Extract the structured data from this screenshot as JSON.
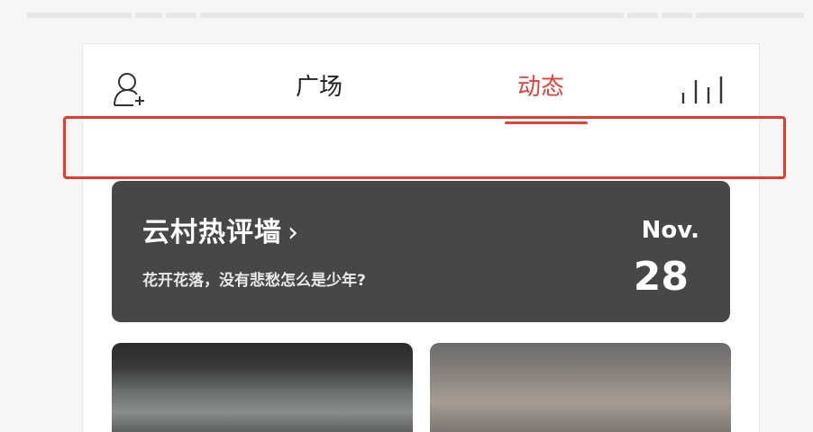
{
  "nav": {
    "left_icon": "add-user-icon",
    "tabs": [
      {
        "label": "广场"
      },
      {
        "label": "动态"
      }
    ],
    "right_icon": "bar-chart-icon"
  },
  "banner": {
    "title": "云村热评墙",
    "title_arrow": "›",
    "subtitle": "花开花落，没有悲愁怎么是少年?",
    "month": "Nov.",
    "day": "28"
  },
  "colors": {
    "accent": "#e0413a",
    "highlight_box": "#e53b2e",
    "banner_bg": "#474747"
  }
}
